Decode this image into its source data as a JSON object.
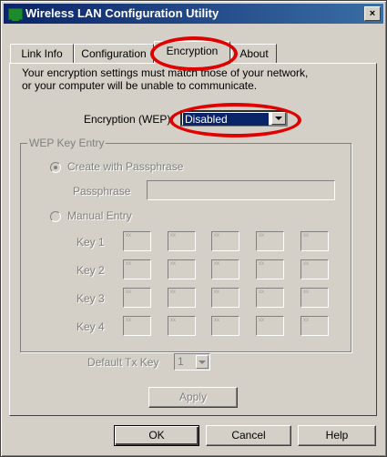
{
  "window": {
    "title": "Wireless LAN Configuration Utility",
    "close_glyph": "×"
  },
  "tabs": [
    {
      "label": "Link Info"
    },
    {
      "label": "Configuration"
    },
    {
      "label": "Encryption",
      "active": true
    },
    {
      "label": "About"
    }
  ],
  "info": {
    "line1": "Your encryption settings must match those of your network,",
    "line2": "or your computer will be unable to communicate."
  },
  "encryption": {
    "label": "Encryption (WEP)",
    "selected": "Disabled"
  },
  "wep": {
    "group_title": "WEP Key Entry",
    "passphrase_option": "Create with Passphrase",
    "passphrase_label": "Passphrase",
    "passphrase_value": "",
    "manual_option": "Manual Entry",
    "keys": [
      {
        "label": "Key 1",
        "values": [
          "xx",
          "xx",
          "xx",
          "xx",
          "xx"
        ]
      },
      {
        "label": "Key 2",
        "values": [
          "xx",
          "xx",
          "xx",
          "xx",
          "xx"
        ]
      },
      {
        "label": "Key 3",
        "values": [
          "xx",
          "xx",
          "xx",
          "xx",
          "xx"
        ]
      },
      {
        "label": "Key 4",
        "values": [
          "xx",
          "xx",
          "xx",
          "xx",
          "xx"
        ]
      }
    ],
    "default_tx_label": "Default Tx Key",
    "default_tx_value": "1",
    "apply_label": "Apply"
  },
  "buttons": {
    "ok": "OK",
    "cancel": "Cancel",
    "help": "Help"
  },
  "colors": {
    "titlebar": "#0a246a",
    "highlight_ring": "#e00000",
    "selection": "#0a246a"
  }
}
